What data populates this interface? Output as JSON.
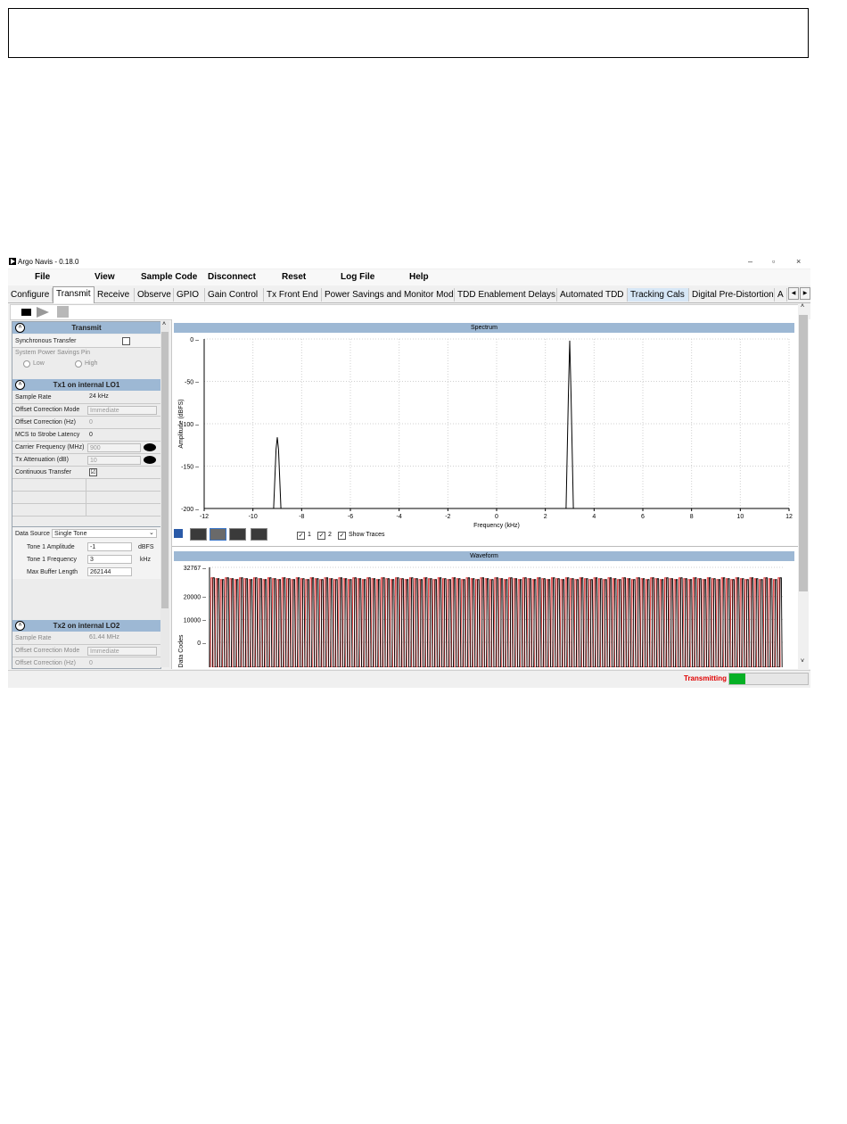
{
  "window": {
    "title": "Argo Navis - 0.18.0",
    "minimize": "–",
    "restore": "▫",
    "close": "×"
  },
  "menu": [
    "File",
    "View",
    "Sample Code",
    "Disconnect",
    "Reset",
    "Log File",
    "Help"
  ],
  "tabs": [
    "Configure",
    "Transmit",
    "Receive",
    "Observe",
    "GPIO",
    "Gain Control",
    "Tx Front End",
    "Power Savings and Monitor Mode",
    "TDD Enablement Delays",
    "Automated TDD",
    "Tracking Cals",
    "Digital Pre-Distortion",
    "A"
  ],
  "active_tab": "Transmit",
  "transmit": {
    "title": "Transmit",
    "sync_transfer_label": "Synchronous Transfer",
    "power_pin_label": "System Power Savings Pin",
    "low_label": "Low",
    "high_label": "High"
  },
  "tx1": {
    "title": "Tx1 on internal LO1",
    "rows": [
      {
        "label": "Sample Rate",
        "value": "24 kHz"
      },
      {
        "label": "Offset Correction Mode",
        "value": "Immediate"
      },
      {
        "label": "Offset Correction (Hz)",
        "value": "0"
      },
      {
        "label": "MCS to Strobe Latency",
        "value": "0"
      },
      {
        "label": "Carrier Frequency (MHz)",
        "value": "900"
      },
      {
        "label": "Tx Attenuation (dB)",
        "value": "10"
      },
      {
        "label": "Continuous Transfer",
        "value": "☑"
      }
    ],
    "data_source_label": "Data Source",
    "data_source_value": "Single Tone",
    "tone_amp_label": "Tone 1 Amplitude",
    "tone_amp_value": "-1",
    "tone_amp_unit": "dBFS",
    "tone_freq_label": "Tone 1 Frequency",
    "tone_freq_value": "3",
    "tone_freq_unit": "kHz",
    "buffer_label": "Max Buffer Length",
    "buffer_value": "262144"
  },
  "tx2": {
    "title": "Tx2 on internal LO2",
    "rows": [
      {
        "label": "Sample Rate",
        "value": "61.44 MHz"
      },
      {
        "label": "Offset Correction Mode",
        "value": "Immediate"
      },
      {
        "label": "Offset Correction (Hz)",
        "value": "0"
      }
    ]
  },
  "spectrum": {
    "title": "Spectrum",
    "trace1_label": "1",
    "trace2_label": "2",
    "show_traces_label": "Show Traces"
  },
  "waveform": {
    "title": "Waveform"
  },
  "status": {
    "text": "Transmitting",
    "progress": 0.2
  },
  "colors": {
    "header_blue": "#9db8d4",
    "waveform_red": "#e03030",
    "status_red": "#e00000",
    "progress_green": "#06b025"
  },
  "chart_data": [
    {
      "type": "line",
      "title": "Spectrum",
      "xlabel": "Frequency (kHz)",
      "ylabel": "Amplitude (dBFS)",
      "xlim": [
        -12,
        12
      ],
      "ylim": [
        -200,
        0
      ],
      "x_ticks": [
        "-12",
        "-10",
        "-8",
        "-6",
        "-4",
        "-2",
        "0",
        "2",
        "4",
        "6",
        "8",
        "10",
        "12"
      ],
      "y_ticks": [
        "0",
        "-50",
        "-100",
        "-150",
        "-200"
      ],
      "grid": true,
      "series": [
        {
          "x": [
            -12,
            -9.15,
            -9.05,
            -9.0,
            -8.95,
            -8.85,
            2.85,
            2.95,
            3.0,
            3.05,
            3.15,
            12
          ],
          "y": [
            -200,
            -200,
            -130,
            -116,
            -130,
            -200,
            -200,
            -60,
            -2,
            -60,
            -200,
            -200
          ]
        }
      ]
    },
    {
      "type": "line",
      "title": "Waveform",
      "ylabel": "Data Codes",
      "y_ticks": [
        "32767",
        "20000",
        "10000",
        "0"
      ],
      "grid": true,
      "series": [
        {
          "color": "#e03030",
          "period_samples": 8,
          "amplitude": 32767
        },
        {
          "color": "#000000",
          "period_samples": 8,
          "amplitude": 32767
        }
      ]
    }
  ]
}
